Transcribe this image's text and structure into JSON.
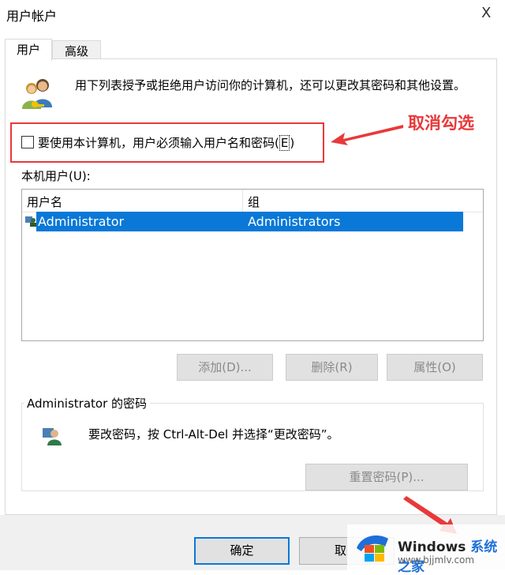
{
  "window": {
    "title": "用户帐户",
    "close_glyph": "X"
  },
  "tabs": [
    {
      "label": "用户",
      "active": true
    },
    {
      "label": "高级",
      "active": false
    }
  ],
  "intro_text": "用下列表授予或拒绝用户访问你的计算机，还可以更改其密码和其他设置。",
  "require_password_checkbox": {
    "label_prefix": "要使用本计算机，用户必须输入用户名和密码(",
    "label_accel": "E",
    "label_suffix": ")",
    "checked": false
  },
  "annotation": {
    "text": "取消勾选",
    "color": "#e8393a"
  },
  "local_users": {
    "label": "本机用户(U):",
    "columns": [
      "用户名",
      "组"
    ],
    "rows": [
      {
        "username": "Administrator",
        "group": "Administrators",
        "selected": true
      }
    ]
  },
  "buttons": {
    "add": "添加(D)...",
    "remove": "删除(R)",
    "properties": "属性(O)",
    "reset_password": "重置密码(P)...",
    "ok": "确定",
    "cancel": "取"
  },
  "password_group": {
    "title": "Administrator 的密码",
    "text": "要改密码，按 Ctrl-Alt-Del 并选择“更改密码”。"
  },
  "watermark": {
    "brand": "Windows",
    "suffix": "系统之家",
    "url": "www.bjjmlv.com"
  },
  "colors": {
    "selection": "#0a78d7",
    "annotation": "#e8393a",
    "footer": "#f0f0f0"
  },
  "icons": [
    "users-icon",
    "user-row-icon",
    "password-user-icon",
    "windows-logo-icon"
  ]
}
